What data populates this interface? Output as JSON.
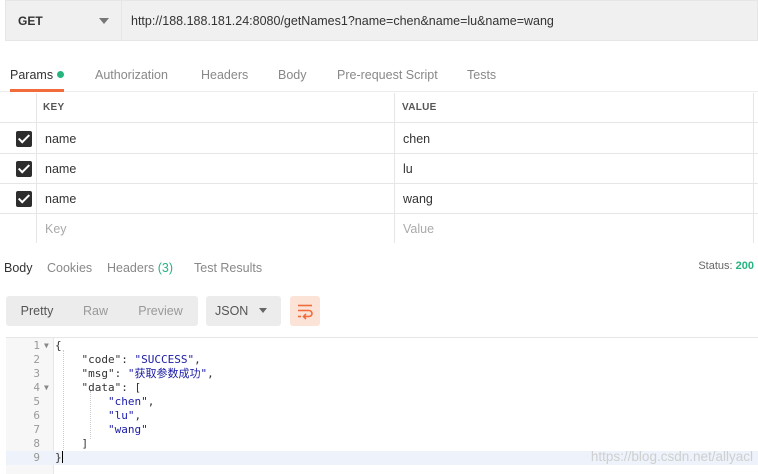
{
  "request": {
    "method": "GET",
    "url": "http://188.188.181.24:8080/getNames1?name=chen&name=lu&name=wang"
  },
  "request_tabs": {
    "params": "Params",
    "authorization": "Authorization",
    "headers": "Headers",
    "body": "Body",
    "prerequest": "Pre-request Script",
    "tests": "Tests"
  },
  "params": {
    "header_key": "KEY",
    "header_value": "VALUE",
    "rows": [
      {
        "key": "name",
        "value": "chen",
        "checked": true
      },
      {
        "key": "name",
        "value": "lu",
        "checked": true
      },
      {
        "key": "name",
        "value": "wang",
        "checked": true
      }
    ],
    "key_placeholder": "Key",
    "value_placeholder": "Value"
  },
  "response_tabs": {
    "body": "Body",
    "cookies": "Cookies",
    "headers": "Headers",
    "headers_count": "(3)",
    "test_results": "Test Results",
    "status_label": "Status:",
    "status_value": "200"
  },
  "view_modes": {
    "pretty": "Pretty",
    "raw": "Raw",
    "preview": "Preview",
    "format": "JSON"
  },
  "response_body": {
    "lines": [
      {
        "n": "1",
        "fold": true
      },
      {
        "n": "2"
      },
      {
        "n": "3"
      },
      {
        "n": "4",
        "fold": true
      },
      {
        "n": "5"
      },
      {
        "n": "6"
      },
      {
        "n": "7"
      },
      {
        "n": "8"
      },
      {
        "n": "9"
      }
    ],
    "open_brace": "{",
    "code_key": "\"code\"",
    "code_value": "\"SUCCESS\"",
    "msg_key": "\"msg\"",
    "msg_value": "\"获取参数成功\"",
    "data_key": "\"data\"",
    "data_open": "[",
    "item1": "\"chen\"",
    "item2": "\"lu\"",
    "item3": "\"wang\"",
    "data_close": "]",
    "close_brace": "}"
  },
  "watermark": "https://blog.csdn.net/allyacl",
  "colors": {
    "accent": "#f26b3a",
    "success": "#26b47f",
    "string": "#1a1aa6"
  },
  "icons": {
    "wrap": "wrap-lines-icon",
    "check": "checkbox-checked-icon",
    "caret": "chevron-down-icon"
  }
}
